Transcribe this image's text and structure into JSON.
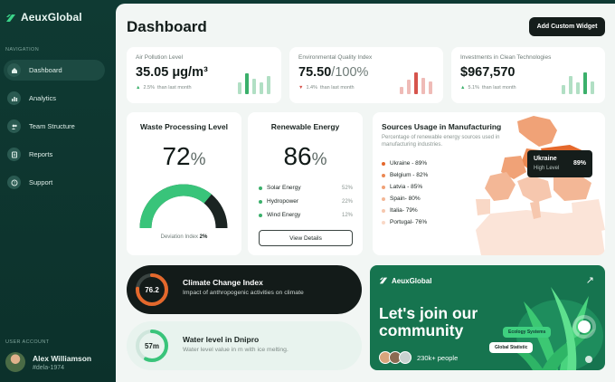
{
  "app": {
    "name": "AeuxGlobal"
  },
  "sidebar": {
    "nav_caption": "NAVIGATION",
    "items": [
      {
        "label": "Dashboard",
        "icon": "home-icon",
        "active": true
      },
      {
        "label": "Analytics",
        "icon": "chart-icon",
        "active": false
      },
      {
        "label": "Team Structure",
        "icon": "people-icon",
        "active": false
      },
      {
        "label": "Reports",
        "icon": "report-icon",
        "active": false
      },
      {
        "label": "Support",
        "icon": "help-icon",
        "active": false
      }
    ],
    "user_caption": "USER ACCOUNT",
    "user": {
      "name": "Alex Williamson",
      "handle": "#dela-1974"
    }
  },
  "header": {
    "title": "Dashboard",
    "add_widget_label": "Add Custom Widget"
  },
  "stats": [
    {
      "title": "Air Pollution Level",
      "value": "35.05 μg/m³",
      "value_suffix": "",
      "delta": "2.5%",
      "delta_dir": "up",
      "delta_text": "than last month",
      "accent": "#3bb06b",
      "bars": [
        0.55,
        0.95,
        0.7,
        0.55,
        0.85
      ]
    },
    {
      "title": "Environmental Quality Index",
      "value": "75.50",
      "value_suffix": "/100%",
      "delta": "1.4%",
      "delta_dir": "down",
      "delta_text": "than last month",
      "accent": "#d6544c",
      "bars": [
        0.35,
        0.65,
        1.0,
        0.75,
        0.6
      ]
    },
    {
      "title": "Investments in Clean Technologies",
      "value": "$967,570",
      "value_suffix": "",
      "delta": "5.1%",
      "delta_dir": "up",
      "delta_text": "than last month",
      "accent": "#3bb06b",
      "bars": [
        0.4,
        0.85,
        0.55,
        1.0,
        0.6
      ]
    }
  ],
  "waste": {
    "title": "Waste Processing Level",
    "value": "72",
    "unit": "%",
    "level": 0.72,
    "deviation_label": "Deviation Index",
    "deviation_value": "2%"
  },
  "renewable": {
    "title": "Renewable Energy",
    "value": "86",
    "unit": "%",
    "items": [
      {
        "name": "Solar Energy",
        "value": "52%"
      },
      {
        "name": "Hydropower",
        "value": "22%"
      },
      {
        "name": "Wind Energy",
        "value": "12%"
      }
    ],
    "button_label": "View Details"
  },
  "sources": {
    "title": "Sources Usage in Manufacturing",
    "subtitle": "Percentage of renewable energy sources used in manufacturing industries.",
    "items": [
      {
        "label": "Ukraine - 89%",
        "color": "#e4682c"
      },
      {
        "label": "Belgium - 82%",
        "color": "#eb8852"
      },
      {
        "label": "Latvia - 85%",
        "color": "#f0a277"
      },
      {
        "label": "Spain- 80%",
        "color": "#f3b796"
      },
      {
        "label": "Italia- 79%",
        "color": "#f6c7ae"
      },
      {
        "label": "Portugal- 76%",
        "color": "#f9d8c6"
      }
    ],
    "tooltip": {
      "name": "Ukraine",
      "level": "High Level",
      "value": "89%"
    }
  },
  "climate": {
    "value": "76.2",
    "level": 0.762,
    "title": "Climate Change Index",
    "subtitle": "Impact of anthropogenic activities on climate"
  },
  "water": {
    "value": "57m",
    "level": 0.57,
    "title": "Water level in Dnipro",
    "subtitle": "Water level value in m with ice melting."
  },
  "promo": {
    "brand": "AeuxGlobal",
    "headline": "Let's join our community",
    "count": "230k+ people",
    "chips": [
      "Ecology Systems",
      "Global Statistic"
    ]
  }
}
